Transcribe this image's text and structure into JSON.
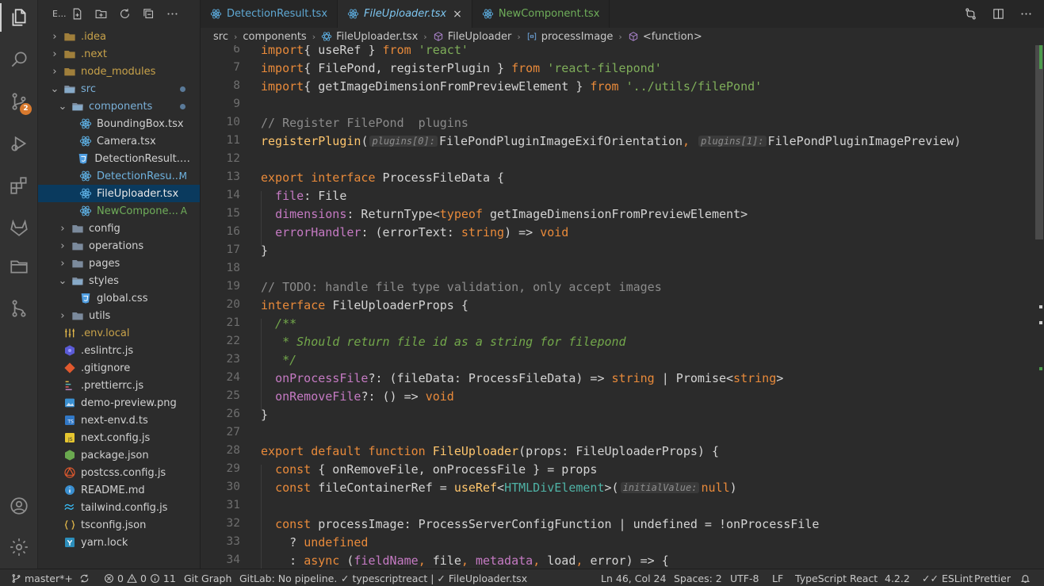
{
  "activity": {
    "scm_badge": "2"
  },
  "sidebar": {
    "title": "E...",
    "items": [
      {
        "label": ".idea",
        "kind": "folder",
        "depth": 0,
        "open": false,
        "color": "#c8a24a"
      },
      {
        "label": ".next",
        "kind": "folder",
        "depth": 0,
        "open": false,
        "color": "#c8a24a"
      },
      {
        "label": "node_modules",
        "kind": "folder",
        "depth": 0,
        "open": false,
        "color": "#c8a24a"
      },
      {
        "label": "src",
        "kind": "folder",
        "depth": 0,
        "open": true,
        "color": "#7ab0d8",
        "dot": true
      },
      {
        "label": "components",
        "kind": "folder",
        "depth": 1,
        "open": true,
        "color": "#7ab0d8",
        "dot": true
      },
      {
        "label": "BoundingBox.tsx",
        "kind": "react",
        "depth": 2,
        "color": "#d0d0d0"
      },
      {
        "label": "Camera.tsx",
        "kind": "react",
        "depth": 2,
        "color": "#d0d0d0"
      },
      {
        "label": "DetectionResult.mo...",
        "kind": "css",
        "depth": 2,
        "color": "#d0d0d0"
      },
      {
        "label": "DetectionResu...",
        "kind": "react",
        "depth": 2,
        "color": "#6fb3e0",
        "status": "M"
      },
      {
        "label": "FileUploader.tsx",
        "kind": "react",
        "depth": 2,
        "color": "#e8e8e8",
        "selected": true
      },
      {
        "label": "NewCompone...",
        "kind": "react",
        "depth": 2,
        "color": "#6fae5a",
        "status": "A"
      },
      {
        "label": "config",
        "kind": "folder",
        "depth": 1,
        "open": false,
        "color": "#d0d0d0"
      },
      {
        "label": "operations",
        "kind": "folder",
        "depth": 1,
        "open": false,
        "color": "#d0d0d0"
      },
      {
        "label": "pages",
        "kind": "folder",
        "depth": 1,
        "open": false,
        "color": "#d0d0d0"
      },
      {
        "label": "styles",
        "kind": "folder",
        "depth": 1,
        "open": true,
        "color": "#d0d0d0"
      },
      {
        "label": "global.css",
        "kind": "css",
        "depth": 2,
        "color": "#d0d0d0"
      },
      {
        "label": "utils",
        "kind": "folder",
        "depth": 1,
        "open": false,
        "color": "#d0d0d0"
      },
      {
        "label": ".env.local",
        "kind": "env",
        "depth": 0,
        "color": "#c8a24a"
      },
      {
        "label": ".eslintrc.js",
        "kind": "eslint",
        "depth": 0,
        "color": "#d0d0d0"
      },
      {
        "label": ".gitignore",
        "kind": "git",
        "depth": 0,
        "color": "#d0d0d0"
      },
      {
        "label": ".prettierrc.js",
        "kind": "prettier",
        "depth": 0,
        "color": "#d0d0d0"
      },
      {
        "label": "demo-preview.png",
        "kind": "image",
        "depth": 0,
        "color": "#d0d0d0"
      },
      {
        "label": "next-env.d.ts",
        "kind": "ts",
        "depth": 0,
        "color": "#d0d0d0"
      },
      {
        "label": "next.config.js",
        "kind": "js",
        "depth": 0,
        "color": "#d0d0d0"
      },
      {
        "label": "package.json",
        "kind": "node",
        "depth": 0,
        "color": "#d0d0d0"
      },
      {
        "label": "postcss.config.js",
        "kind": "postcss",
        "depth": 0,
        "color": "#d0d0d0"
      },
      {
        "label": "README.md",
        "kind": "info",
        "depth": 0,
        "color": "#d0d0d0"
      },
      {
        "label": "tailwind.config.js",
        "kind": "tailwind",
        "depth": 0,
        "color": "#d0d0d0"
      },
      {
        "label": "tsconfig.json",
        "kind": "json",
        "depth": 0,
        "color": "#d0d0d0"
      },
      {
        "label": "yarn.lock",
        "kind": "yarn",
        "depth": 0,
        "color": "#d0d0d0"
      }
    ]
  },
  "tabs": [
    {
      "label": "DetectionResult.tsx",
      "active": false
    },
    {
      "label": "FileUploader.tsx",
      "active": true,
      "close": "×"
    },
    {
      "label": "NewComponent.tsx",
      "active": false
    }
  ],
  "breadcrumb": [
    "src",
    "components",
    "FileUploader.tsx",
    "FileUploader",
    "processImage",
    "<function>"
  ],
  "code": {
    "lines": [
      {
        "n": "6",
        "t": [
          [
            "kw",
            "import"
          ],
          [
            "",
            "{ useRef } "
          ],
          [
            "kw",
            "from"
          ],
          [
            "str",
            " 'react'"
          ]
        ]
      },
      {
        "n": "7",
        "t": [
          [
            "kw",
            "import"
          ],
          [
            "",
            "{ FilePond, registerPlugin } "
          ],
          [
            "kw",
            "from"
          ],
          [
            "str",
            " 'react-filepond'"
          ]
        ]
      },
      {
        "n": "8",
        "t": [
          [
            "kw",
            "import"
          ],
          [
            "",
            "{ getImageDimensionFromPreviewElement } "
          ],
          [
            "kw",
            "from"
          ],
          [
            "str",
            " '../utils/filePond'"
          ]
        ]
      },
      {
        "n": "9",
        "t": []
      },
      {
        "n": "10",
        "t": [
          [
            "cm",
            "// Register FilePond  plugins"
          ]
        ]
      },
      {
        "n": "11",
        "t": [
          [
            "fn",
            "registerPlugin"
          ],
          [
            "",
            "("
          ],
          [
            "hint",
            "plugins[0]:"
          ],
          [
            "",
            "FilePondPluginImageExifOrientation"
          ],
          [
            "kw",
            ", "
          ],
          [
            "hint",
            "plugins[1]:"
          ],
          [
            "",
            "FilePondPluginImagePreview)"
          ]
        ]
      },
      {
        "n": "12",
        "t": []
      },
      {
        "n": "13",
        "t": [
          [
            "kw",
            "export interface "
          ],
          [
            "",
            "ProcessFileData {"
          ]
        ]
      },
      {
        "n": "14",
        "t": [
          [
            "",
            "  "
          ],
          [
            "prop",
            "file"
          ],
          [
            "",
            ": File"
          ]
        ]
      },
      {
        "n": "15",
        "t": [
          [
            "",
            "  "
          ],
          [
            "prop",
            "dimensions"
          ],
          [
            "",
            ": ReturnType<"
          ],
          [
            "kw",
            "typeof"
          ],
          [
            "",
            " getImageDimensionFromPreviewElement>"
          ]
        ]
      },
      {
        "n": "16",
        "t": [
          [
            "",
            "  "
          ],
          [
            "prop",
            "errorHandler"
          ],
          [
            "",
            ": (errorText: "
          ],
          [
            "kw",
            "string"
          ],
          [
            "",
            ") => "
          ],
          [
            "kw",
            "void"
          ]
        ]
      },
      {
        "n": "17",
        "t": [
          [
            "",
            "}"
          ]
        ]
      },
      {
        "n": "18",
        "t": []
      },
      {
        "n": "19",
        "t": [
          [
            "cm",
            "// TODO: handle file type validation, only accept images"
          ]
        ]
      },
      {
        "n": "20",
        "t": [
          [
            "kw",
            "interface "
          ],
          [
            "",
            "FileUploaderProps {"
          ]
        ]
      },
      {
        "n": "21",
        "t": [
          [
            "doc",
            "  /**"
          ]
        ]
      },
      {
        "n": "22",
        "t": [
          [
            "doc",
            "   * Should return file id as a string for filepond"
          ]
        ]
      },
      {
        "n": "23",
        "t": [
          [
            "doc",
            "   */"
          ]
        ]
      },
      {
        "n": "24",
        "t": [
          [
            "",
            "  "
          ],
          [
            "prop",
            "onProcessFile"
          ],
          [
            "",
            "?: (fileData: ProcessFileData) => "
          ],
          [
            "kw",
            "string"
          ],
          [
            "",
            " | Promise<"
          ],
          [
            "kw",
            "string"
          ],
          [
            "",
            ">"
          ]
        ]
      },
      {
        "n": "25",
        "t": [
          [
            "",
            "  "
          ],
          [
            "prop",
            "onRemoveFile"
          ],
          [
            "",
            "?: () => "
          ],
          [
            "kw",
            "void"
          ]
        ]
      },
      {
        "n": "26",
        "t": [
          [
            "",
            "}"
          ]
        ]
      },
      {
        "n": "27",
        "t": []
      },
      {
        "n": "28",
        "t": [
          [
            "kw",
            "export default function "
          ],
          [
            "fn",
            "FileUploader"
          ],
          [
            "",
            "(props: FileUploaderProps) {"
          ]
        ]
      },
      {
        "n": "29",
        "t": [
          [
            "",
            "  "
          ],
          [
            "kw",
            "const"
          ],
          [
            "",
            " { onRemoveFile, onProcessFile } = props"
          ]
        ]
      },
      {
        "n": "30",
        "t": [
          [
            "",
            "  "
          ],
          [
            "kw",
            "const"
          ],
          [
            "",
            " fileContainerRef = "
          ],
          [
            "fn",
            "useRef"
          ],
          [
            "",
            "<"
          ],
          [
            "tp",
            "HTMLDivElement"
          ],
          [
            "",
            ">("
          ],
          [
            "hint",
            "initialValue:"
          ],
          [
            "kw",
            "null"
          ],
          [
            "",
            ")"
          ]
        ]
      },
      {
        "n": "31",
        "t": []
      },
      {
        "n": "32",
        "t": [
          [
            "",
            "  "
          ],
          [
            "kw",
            "const"
          ],
          [
            "",
            " processImage: ProcessServerConfigFunction | undefined = !onProcessFile"
          ]
        ]
      },
      {
        "n": "33",
        "t": [
          [
            "",
            "    ? "
          ],
          [
            "kw",
            "undefined"
          ]
        ]
      },
      {
        "n": "34",
        "t": [
          [
            "",
            "    : "
          ],
          [
            "kw",
            "async"
          ],
          [
            "",
            " ("
          ],
          [
            "prop",
            "fieldName"
          ],
          [
            "kw",
            ", "
          ],
          [
            "",
            "file"
          ],
          [
            "kw",
            ", "
          ],
          [
            "prop",
            "metadata"
          ],
          [
            "kw",
            ", "
          ],
          [
            "",
            "load"
          ],
          [
            "kw",
            ", "
          ],
          [
            "",
            "error) => {"
          ]
        ]
      }
    ]
  },
  "status": {
    "branch": "master*+",
    "errors": "0",
    "warnings": "0",
    "info": "11",
    "git_graph": "Git Graph",
    "gitlab": "GitLab: No pipeline.",
    "lang_check": "typescriptreact |",
    "file": "FileUploader.tsx",
    "position": "Ln 46, Col 24",
    "spaces": "Spaces: 2",
    "encoding": "UTF-8",
    "eol": "LF",
    "language": "TypeScript React",
    "ts_version": "4.2.2",
    "eslint": "ESLint",
    "prettier": "Prettier"
  }
}
